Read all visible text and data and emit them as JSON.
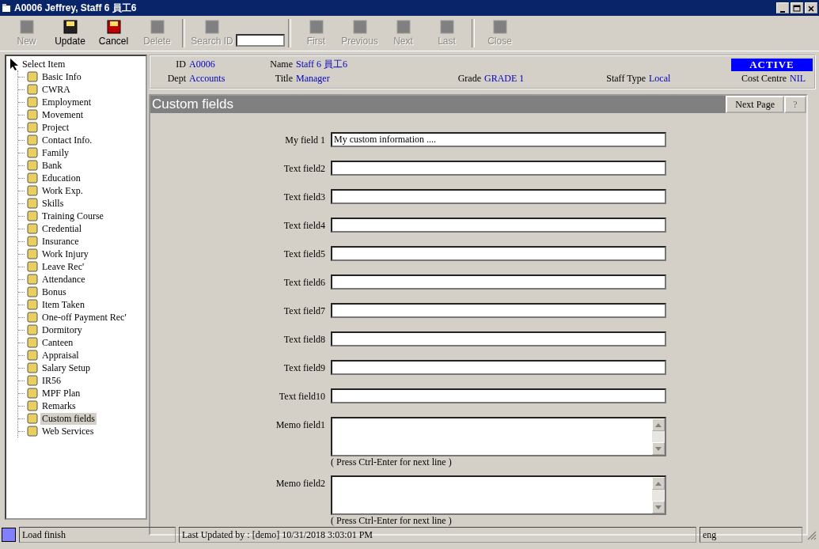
{
  "window": {
    "title": "A0006 Jeffrey, Staff 6 員工6"
  },
  "toolbar": {
    "buttons": [
      {
        "label": "New",
        "disabled": true
      },
      {
        "label": "Update",
        "disabled": false
      },
      {
        "label": "Cancel",
        "disabled": false
      },
      {
        "label": "Delete",
        "disabled": true
      }
    ],
    "search": {
      "label": "Search ID",
      "disabled": true
    },
    "nav_buttons": [
      {
        "label": "First",
        "disabled": true
      },
      {
        "label": "Previous",
        "disabled": true
      },
      {
        "label": "Next",
        "disabled": true
      },
      {
        "label": "Last",
        "disabled": true
      }
    ],
    "close_button": {
      "label": "Close",
      "disabled": true
    }
  },
  "tree": {
    "label": "Select Item",
    "children": [
      {
        "label": "Basic Info",
        "selected": false
      },
      {
        "label": "CWRA",
        "selected": false
      },
      {
        "label": "Employment",
        "selected": false
      },
      {
        "label": "Movement",
        "selected": false
      },
      {
        "label": "Project",
        "selected": false
      },
      {
        "label": "Contact Info.",
        "selected": false
      },
      {
        "label": "Family",
        "selected": false
      },
      {
        "label": "Bank",
        "selected": false
      },
      {
        "label": "Education",
        "selected": false
      },
      {
        "label": "Work Exp.",
        "selected": false
      },
      {
        "label": "Skills",
        "selected": false
      },
      {
        "label": "Training Course",
        "selected": false
      },
      {
        "label": "Credential",
        "selected": false
      },
      {
        "label": "Insurance",
        "selected": false
      },
      {
        "label": "Work Injury",
        "selected": false
      },
      {
        "label": "Leave Rec'",
        "selected": false
      },
      {
        "label": "Attendance",
        "selected": false
      },
      {
        "label": "Bonus",
        "selected": false
      },
      {
        "label": "Item Taken",
        "selected": false
      },
      {
        "label": "One-off Payment Rec'",
        "selected": false
      },
      {
        "label": "Dormitory",
        "selected": false
      },
      {
        "label": "Canteen",
        "selected": false
      },
      {
        "label": "Appraisal",
        "selected": false
      },
      {
        "label": "Salary Setup",
        "selected": false
      },
      {
        "label": "IR56",
        "selected": false
      },
      {
        "label": "MPF Plan",
        "selected": false
      },
      {
        "label": "Remarks",
        "selected": false
      },
      {
        "label": "Custom fields",
        "selected": true
      },
      {
        "label": "Web Services",
        "selected": false
      }
    ]
  },
  "header": {
    "id": {
      "label": "ID",
      "value": "A0006"
    },
    "dept": {
      "label": "Dept",
      "value": "Accounts"
    },
    "name": {
      "label": "Name",
      "value": "Staff 6  員工6"
    },
    "title": {
      "label": "Title",
      "value": "Manager"
    },
    "grade": {
      "label": "Grade",
      "value": "GRADE 1"
    },
    "staff_type": {
      "label": "Staff Type",
      "value": "Local"
    },
    "cost_centre": {
      "label": "Cost Centre",
      "value": "NIL"
    },
    "status": "ACTIVE"
  },
  "section": {
    "title": "Custom fields",
    "next_button": "Next Page",
    "help_button": "?"
  },
  "fields": [
    {
      "kind": "text",
      "label": "My field 1",
      "value": "My custom information ...."
    },
    {
      "kind": "text",
      "label": "Text field2"
    },
    {
      "kind": "text",
      "label": "Text field3"
    },
    {
      "kind": "text",
      "label": "Text field4"
    },
    {
      "kind": "text",
      "label": "Text field5"
    },
    {
      "kind": "text",
      "label": "Text field6"
    },
    {
      "kind": "text",
      "label": "Text field7"
    },
    {
      "kind": "text",
      "label": "Text field8"
    },
    {
      "kind": "text",
      "label": "Text field9"
    },
    {
      "kind": "text",
      "label": "Text field10"
    },
    {
      "kind": "memo",
      "label": "Memo field1",
      "hint": "( Press Ctrl-Enter for next line )"
    },
    {
      "kind": "memo",
      "label": "Memo field2",
      "hint": "( Press Ctrl-Enter for next line )"
    }
  ],
  "status_bar": {
    "message": "Load finish",
    "last_updated": "Last Updated by : [demo]  10/31/2018 3:03:01 PM",
    "language": "eng"
  }
}
